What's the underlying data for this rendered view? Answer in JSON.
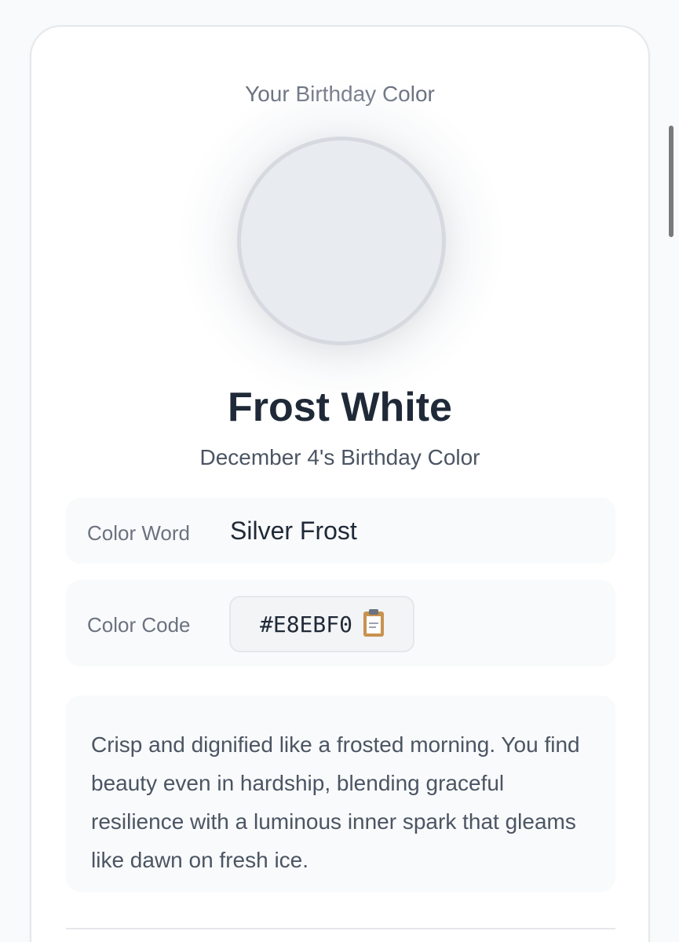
{
  "header": {
    "subtitle": "Your Birthday Color"
  },
  "swatch": {
    "fill_color": "#E8EBF0",
    "border_color": "#D6DAE0"
  },
  "result": {
    "color_name": "Frost White",
    "date_line": "December 4's Birthday Color"
  },
  "details": {
    "word_label": "Color Word",
    "word_value": "Silver Frost",
    "code_label": "Color Code",
    "code_value": "#E8EBF0",
    "copy_icon": "clipboard-icon"
  },
  "description": "Crisp and dignified like a frosted morning. You find beauty even in hardship, blending graceful resilience with a luminous inner spark that gleams like dawn on fresh ice."
}
